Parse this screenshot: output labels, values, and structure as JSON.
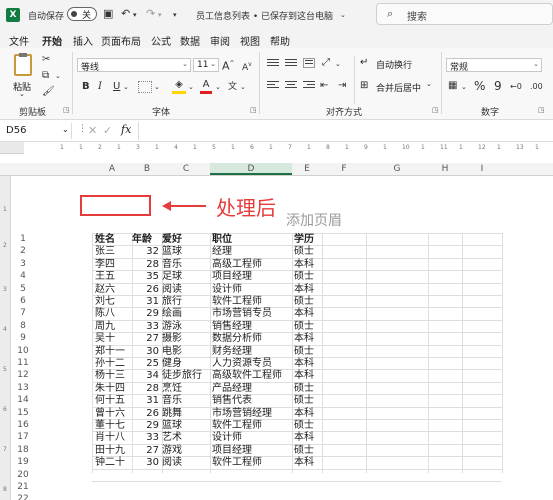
{
  "titlebar": {
    "autosave_label": "自动保存",
    "autosave_state": "关",
    "doc_title": "员工信息列表 • 已保存到这台电脑",
    "search_placeholder": "搜索"
  },
  "menu": [
    "文件",
    "开始",
    "插入",
    "页面布局",
    "公式",
    "数据",
    "审阅",
    "视图",
    "帮助"
  ],
  "menu_active": 1,
  "ribbon": {
    "paste_label": "粘贴",
    "clipboard_label": "剪贴板",
    "font_name": "等线",
    "font_size": "11",
    "grow_font": "A",
    "shrink_font": "A",
    "bold": "B",
    "italic": "I",
    "underline": "U",
    "font_color_glyph": "A",
    "font_group_label": "字体",
    "wrap_text": "自动换行",
    "merge_center": "合并后居中",
    "align_group_label": "对齐方式",
    "number_format": "常规",
    "percent": "%",
    "comma": "9",
    "number_group_label": "数字"
  },
  "formula_bar": {
    "name_box": "D56",
    "fx": "fx",
    "content": ""
  },
  "ruler_marks": [
    "1",
    "1",
    "2",
    "1",
    "3",
    "1",
    "4",
    "1",
    "5",
    "1",
    "6",
    "1",
    "7",
    "1",
    "8",
    "1",
    "9",
    "1",
    "10",
    "1",
    "11",
    "1",
    "12",
    "1",
    "13",
    "1"
  ],
  "columns": [
    "A",
    "B",
    "C",
    "D",
    "E",
    "F",
    "G",
    "H",
    "I"
  ],
  "annotation": {
    "text": "处理后",
    "header_placeholder": "添加页眉"
  },
  "row_numbers": [
    "1",
    "2",
    "3",
    "4",
    "5",
    "6",
    "7",
    "8",
    "9",
    "10",
    "11",
    "12",
    "13",
    "14",
    "15",
    "16",
    "17",
    "18",
    "19",
    "20",
    "21",
    "22"
  ],
  "table": {
    "headers": [
      "姓名",
      "年龄",
      "爱好",
      "职位",
      "学历"
    ],
    "rows": [
      [
        "张三",
        "32",
        "篮球",
        "经理",
        "硕士"
      ],
      [
        "李四",
        "28",
        "音乐",
        "高级工程师",
        "本科"
      ],
      [
        "王五",
        "35",
        "足球",
        "项目经理",
        "硕士"
      ],
      [
        "赵六",
        "26",
        "阅读",
        "设计师",
        "本科"
      ],
      [
        "刘七",
        "31",
        "旅行",
        "软件工程师",
        "硕士"
      ],
      [
        "陈八",
        "29",
        "绘画",
        "市场营销专员",
        "本科"
      ],
      [
        "周九",
        "33",
        "游泳",
        "销售经理",
        "硕士"
      ],
      [
        "吴十",
        "27",
        "摄影",
        "数据分析师",
        "本科"
      ],
      [
        "郑十一",
        "30",
        "电影",
        "财务经理",
        "硕士"
      ],
      [
        "孙十二",
        "25",
        "健身",
        "人力资源专员",
        "本科"
      ],
      [
        "杨十三",
        "34",
        "徒步旅行",
        "高级软件工程师",
        "本科"
      ],
      [
        "朱十四",
        "28",
        "烹饪",
        "产品经理",
        "硕士"
      ],
      [
        "何十五",
        "31",
        "音乐",
        "销售代表",
        "硕士"
      ],
      [
        "曾十六",
        "26",
        "跳舞",
        "市场营销经理",
        "本科"
      ],
      [
        "董十七",
        "29",
        "篮球",
        "软件工程师",
        "硕士"
      ],
      [
        "肖十八",
        "33",
        "艺术",
        "设计师",
        "本科"
      ],
      [
        "田十九",
        "27",
        "游戏",
        "项目经理",
        "硕士"
      ],
      [
        "钟二十",
        "30",
        "阅读",
        "软件工程师",
        "本科"
      ]
    ]
  },
  "colors": {
    "accent": "#1e7145",
    "annotation": "#e53b3b",
    "excel_green": "#107c41"
  }
}
